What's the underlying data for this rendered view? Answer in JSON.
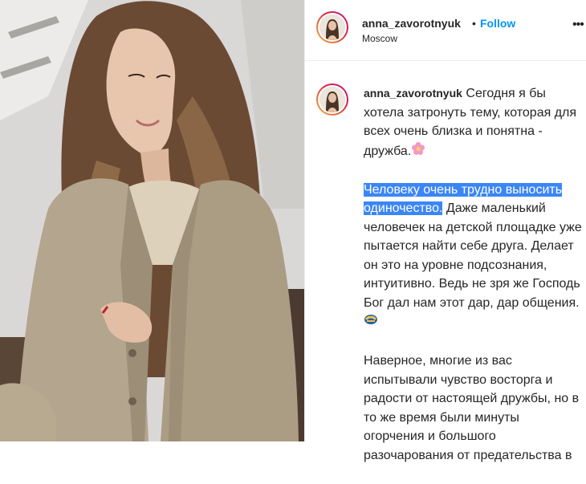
{
  "post": {
    "username": "anna_zavorotnyuk",
    "separator": "•",
    "follow_label": "Follow",
    "location": "Moscow",
    "more_label": "•••"
  },
  "caption": {
    "p1": "Сегодня я бы хотела затронуть тему, которая для всех очень близка и понятна - дружба.",
    "p2_highlight": "Человеку очень трудно выносить одиночество.",
    "p2_rest": "Даже маленький человечек на детской площадке уже пытается найти себе друга. Делает он это на уровне подсознания, интуитивно. Ведь не зря же Господь Бог дал нам этот дар, дар общения.",
    "p3": "Наверное, многие из вас испытывали чувство восторга и радости от настоящей дружбы, но в то же время были минуты огорчения и большого разочарования от предательства в"
  },
  "icons": {
    "flower": "flower-emoji-icon",
    "hands": "handshake-emoji-icon",
    "more": "more-options-icon"
  },
  "colors": {
    "follow": "#0095f6",
    "highlight": "#3b86f5",
    "ring_start": "#f7b046",
    "ring_end": "#bc1888"
  }
}
